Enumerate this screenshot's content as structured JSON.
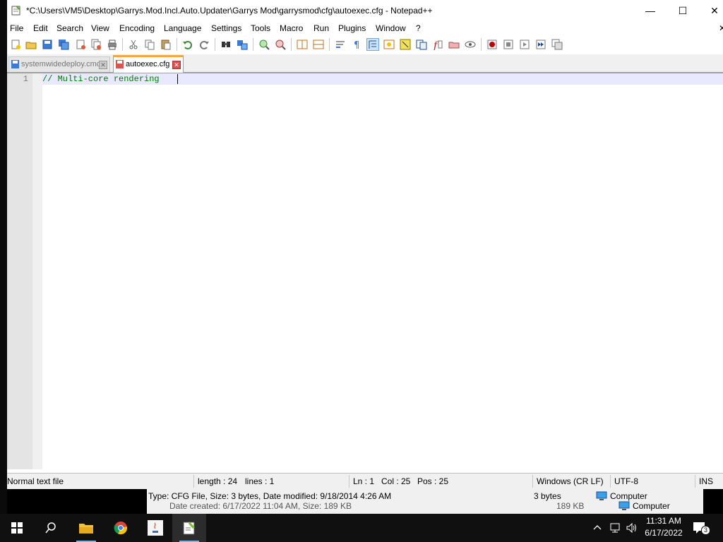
{
  "window": {
    "title": "*C:\\Users\\VM5\\Desktop\\Garrys.Mod.Incl.Auto.Updater\\Garrys Mod\\garrysmod\\cfg\\autoexec.cfg - Notepad++",
    "minimize": "—",
    "maximize": "☐",
    "close": "✕"
  },
  "menu": [
    "File",
    "Edit",
    "Search",
    "View",
    "Encoding",
    "Language",
    "Settings",
    "Tools",
    "Macro",
    "Run",
    "Plugins",
    "Window",
    "?"
  ],
  "menu_close": "✕",
  "tabs": [
    {
      "label": "systemwidedeploy.cmd",
      "active": false
    },
    {
      "label": "autoexec.cfg",
      "active": true
    }
  ],
  "editor": {
    "line_number": "1",
    "line_text": "// Multi-core rendering "
  },
  "status": {
    "file_type": "Normal text file",
    "length": "length : 24",
    "lines": "lines : 1",
    "ln": "Ln : 1",
    "col": "Col : 25",
    "pos": "Pos : 25",
    "eol": "Windows (CR LF)",
    "encoding": "UTF-8",
    "mode": "INS"
  },
  "explorer": {
    "tooltip": "Type: CFG File, Size: 3 bytes, Date modified: 9/18/2014 4:26 AM",
    "created": "Date created: 6/17/2022 11:04 AM, Size: 189 KB",
    "size1": "3 bytes",
    "size2": "189 KB",
    "location1": "Computer",
    "location2": "Computer"
  },
  "taskbar": {
    "time": "11:31 AM",
    "date": "6/17/2022",
    "notifications": "3"
  },
  "colors": {
    "accent_tab": "#f9a836",
    "current_line": "#e8e8ff",
    "comment": "#008000",
    "taskbar": "#101010"
  }
}
